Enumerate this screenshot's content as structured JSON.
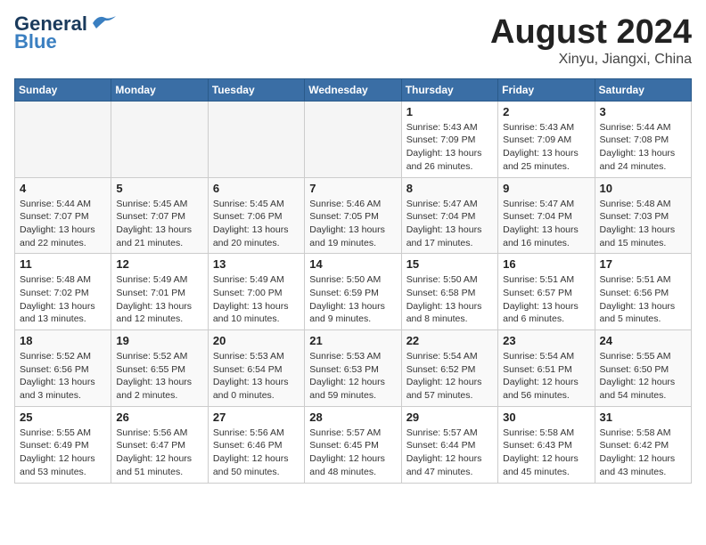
{
  "header": {
    "logo_line1": "General",
    "logo_line2": "Blue",
    "month": "August 2024",
    "location": "Xinyu, Jiangxi, China"
  },
  "days_of_week": [
    "Sunday",
    "Monday",
    "Tuesday",
    "Wednesday",
    "Thursday",
    "Friday",
    "Saturday"
  ],
  "weeks": [
    [
      {
        "day": "",
        "info": ""
      },
      {
        "day": "",
        "info": ""
      },
      {
        "day": "",
        "info": ""
      },
      {
        "day": "",
        "info": ""
      },
      {
        "day": "1",
        "info": "Sunrise: 5:43 AM\nSunset: 7:09 PM\nDaylight: 13 hours\nand 26 minutes."
      },
      {
        "day": "2",
        "info": "Sunrise: 5:43 AM\nSunset: 7:09 AM\nDaylight: 13 hours\nand 25 minutes."
      },
      {
        "day": "3",
        "info": "Sunrise: 5:44 AM\nSunset: 7:08 PM\nDaylight: 13 hours\nand 24 minutes."
      }
    ],
    [
      {
        "day": "4",
        "info": "Sunrise: 5:44 AM\nSunset: 7:07 PM\nDaylight: 13 hours\nand 22 minutes."
      },
      {
        "day": "5",
        "info": "Sunrise: 5:45 AM\nSunset: 7:07 PM\nDaylight: 13 hours\nand 21 minutes."
      },
      {
        "day": "6",
        "info": "Sunrise: 5:45 AM\nSunset: 7:06 PM\nDaylight: 13 hours\nand 20 minutes."
      },
      {
        "day": "7",
        "info": "Sunrise: 5:46 AM\nSunset: 7:05 PM\nDaylight: 13 hours\nand 19 minutes."
      },
      {
        "day": "8",
        "info": "Sunrise: 5:47 AM\nSunset: 7:04 PM\nDaylight: 13 hours\nand 17 minutes."
      },
      {
        "day": "9",
        "info": "Sunrise: 5:47 AM\nSunset: 7:04 PM\nDaylight: 13 hours\nand 16 minutes."
      },
      {
        "day": "10",
        "info": "Sunrise: 5:48 AM\nSunset: 7:03 PM\nDaylight: 13 hours\nand 15 minutes."
      }
    ],
    [
      {
        "day": "11",
        "info": "Sunrise: 5:48 AM\nSunset: 7:02 PM\nDaylight: 13 hours\nand 13 minutes."
      },
      {
        "day": "12",
        "info": "Sunrise: 5:49 AM\nSunset: 7:01 PM\nDaylight: 13 hours\nand 12 minutes."
      },
      {
        "day": "13",
        "info": "Sunrise: 5:49 AM\nSunset: 7:00 PM\nDaylight: 13 hours\nand 10 minutes."
      },
      {
        "day": "14",
        "info": "Sunrise: 5:50 AM\nSunset: 6:59 PM\nDaylight: 13 hours\nand 9 minutes."
      },
      {
        "day": "15",
        "info": "Sunrise: 5:50 AM\nSunset: 6:58 PM\nDaylight: 13 hours\nand 8 minutes."
      },
      {
        "day": "16",
        "info": "Sunrise: 5:51 AM\nSunset: 6:57 PM\nDaylight: 13 hours\nand 6 minutes."
      },
      {
        "day": "17",
        "info": "Sunrise: 5:51 AM\nSunset: 6:56 PM\nDaylight: 13 hours\nand 5 minutes."
      }
    ],
    [
      {
        "day": "18",
        "info": "Sunrise: 5:52 AM\nSunset: 6:56 PM\nDaylight: 13 hours\nand 3 minutes."
      },
      {
        "day": "19",
        "info": "Sunrise: 5:52 AM\nSunset: 6:55 PM\nDaylight: 13 hours\nand 2 minutes."
      },
      {
        "day": "20",
        "info": "Sunrise: 5:53 AM\nSunset: 6:54 PM\nDaylight: 13 hours\nand 0 minutes."
      },
      {
        "day": "21",
        "info": "Sunrise: 5:53 AM\nSunset: 6:53 PM\nDaylight: 12 hours\nand 59 minutes."
      },
      {
        "day": "22",
        "info": "Sunrise: 5:54 AM\nSunset: 6:52 PM\nDaylight: 12 hours\nand 57 minutes."
      },
      {
        "day": "23",
        "info": "Sunrise: 5:54 AM\nSunset: 6:51 PM\nDaylight: 12 hours\nand 56 minutes."
      },
      {
        "day": "24",
        "info": "Sunrise: 5:55 AM\nSunset: 6:50 PM\nDaylight: 12 hours\nand 54 minutes."
      }
    ],
    [
      {
        "day": "25",
        "info": "Sunrise: 5:55 AM\nSunset: 6:49 PM\nDaylight: 12 hours\nand 53 minutes."
      },
      {
        "day": "26",
        "info": "Sunrise: 5:56 AM\nSunset: 6:47 PM\nDaylight: 12 hours\nand 51 minutes."
      },
      {
        "day": "27",
        "info": "Sunrise: 5:56 AM\nSunset: 6:46 PM\nDaylight: 12 hours\nand 50 minutes."
      },
      {
        "day": "28",
        "info": "Sunrise: 5:57 AM\nSunset: 6:45 PM\nDaylight: 12 hours\nand 48 minutes."
      },
      {
        "day": "29",
        "info": "Sunrise: 5:57 AM\nSunset: 6:44 PM\nDaylight: 12 hours\nand 47 minutes."
      },
      {
        "day": "30",
        "info": "Sunrise: 5:58 AM\nSunset: 6:43 PM\nDaylight: 12 hours\nand 45 minutes."
      },
      {
        "day": "31",
        "info": "Sunrise: 5:58 AM\nSunset: 6:42 PM\nDaylight: 12 hours\nand 43 minutes."
      }
    ]
  ]
}
